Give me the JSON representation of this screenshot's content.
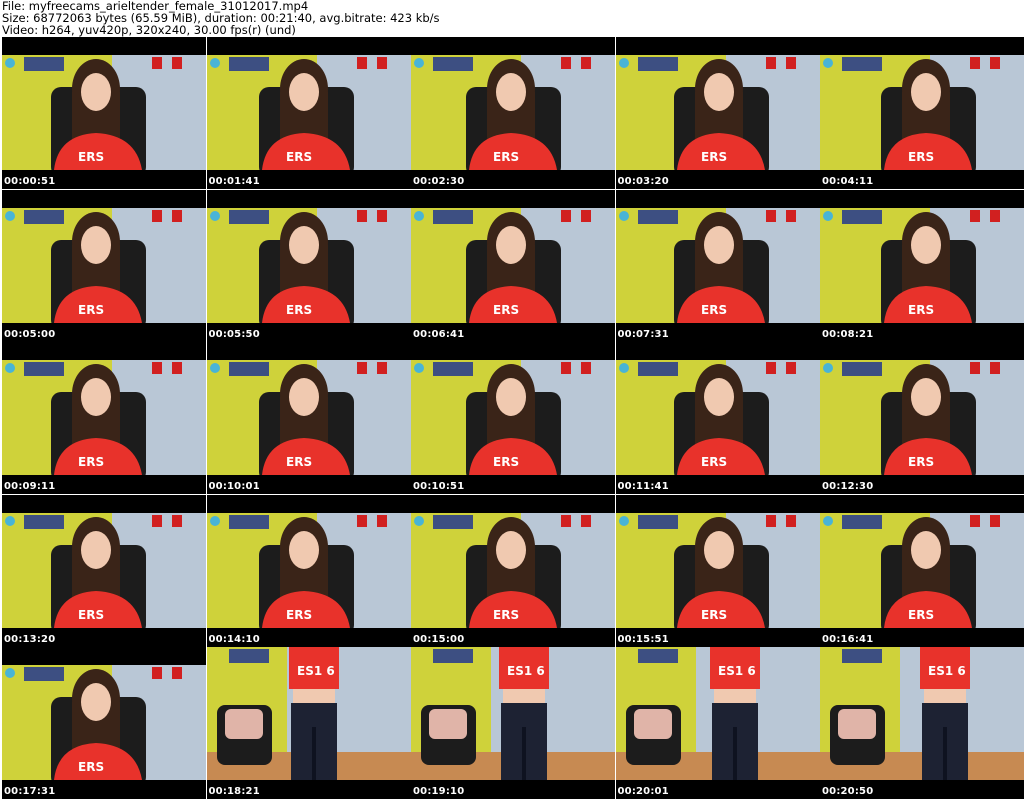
{
  "header": {
    "file_line": "File: myfreecams_arieltender_female_31012017.mp4",
    "size_line": "Size: 68772063 bytes (65.59 MiB), duration: 00:21:40, avg.bitrate: 423 kb/s",
    "video_line": "Video: h264, yuv420p, 320x240, 30.00 fps(r) (und)"
  },
  "thumbnails": [
    {
      "time": "00:00:51",
      "scene": "seated"
    },
    {
      "time": "00:01:41",
      "scene": "seated"
    },
    {
      "time": "00:02:30",
      "scene": "seated"
    },
    {
      "time": "00:03:20",
      "scene": "seated"
    },
    {
      "time": "00:04:11",
      "scene": "seated"
    },
    {
      "time": "00:05:00",
      "scene": "seated"
    },
    {
      "time": "00:05:50",
      "scene": "seated"
    },
    {
      "time": "00:06:41",
      "scene": "seated"
    },
    {
      "time": "00:07:31",
      "scene": "seated"
    },
    {
      "time": "00:08:21",
      "scene": "seated"
    },
    {
      "time": "00:09:11",
      "scene": "seated"
    },
    {
      "time": "00:10:01",
      "scene": "seated"
    },
    {
      "time": "00:10:51",
      "scene": "seated"
    },
    {
      "time": "00:11:41",
      "scene": "seated"
    },
    {
      "time": "00:12:30",
      "scene": "seated"
    },
    {
      "time": "00:13:20",
      "scene": "seated"
    },
    {
      "time": "00:14:10",
      "scene": "seated"
    },
    {
      "time": "00:15:00",
      "scene": "seated"
    },
    {
      "time": "00:15:51",
      "scene": "seated"
    },
    {
      "time": "00:16:41",
      "scene": "seated"
    },
    {
      "time": "00:17:31",
      "scene": "seated"
    },
    {
      "time": "00:18:21",
      "scene": "standing"
    },
    {
      "time": "00:19:10",
      "scene": "standing"
    },
    {
      "time": "00:20:01",
      "scene": "standing"
    },
    {
      "time": "00:20:50",
      "scene": "standing"
    }
  ],
  "colors": {
    "wall_yellow": "#cfd23a",
    "wall_blue": "#b9c7d6",
    "shirt_red": "#e8322b",
    "hair_brown": "#3a2418",
    "skin": "#f0c9b0",
    "chair_black": "#1c1c1c",
    "floor": "#c78a52",
    "jeans": "#1d2233",
    "pillow": "#e0b4a8"
  }
}
